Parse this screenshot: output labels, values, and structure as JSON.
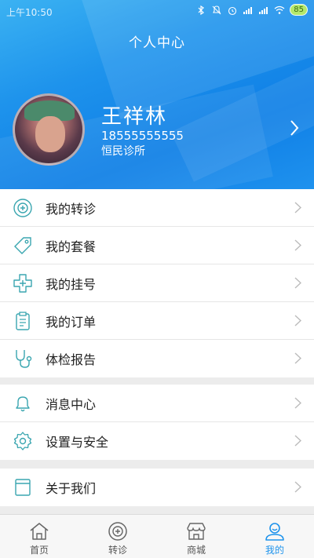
{
  "status_bar": {
    "time": "上午10:50",
    "battery": "85"
  },
  "header": {
    "title": "个人中心",
    "user_name": "王祥林",
    "phone": "18555555555",
    "clinic": "恒民诊所"
  },
  "menu": {
    "group1": [
      {
        "label": "我的转诊",
        "icon": "referral-icon"
      },
      {
        "label": "我的套餐",
        "icon": "tag-icon"
      },
      {
        "label": "我的挂号",
        "icon": "medical-cross-icon"
      },
      {
        "label": "我的订单",
        "icon": "clipboard-icon"
      },
      {
        "label": "体检报告",
        "icon": "stethoscope-icon"
      }
    ],
    "group2": [
      {
        "label": "消息中心",
        "icon": "bell-icon"
      },
      {
        "label": "设置与安全",
        "icon": "gear-icon"
      }
    ],
    "group3": [
      {
        "label": "关于我们",
        "icon": "info-card-icon"
      }
    ]
  },
  "tabbar": [
    {
      "label": "首页",
      "icon": "home-icon",
      "active": false
    },
    {
      "label": "转诊",
      "icon": "referral-tab-icon",
      "active": false
    },
    {
      "label": "商城",
      "icon": "store-icon",
      "active": false
    },
    {
      "label": "我的",
      "icon": "profile-icon",
      "active": true
    }
  ],
  "colors": {
    "accent": "#1e93ec",
    "icon_teal": "#3aa6b0",
    "background": "#ececec"
  }
}
